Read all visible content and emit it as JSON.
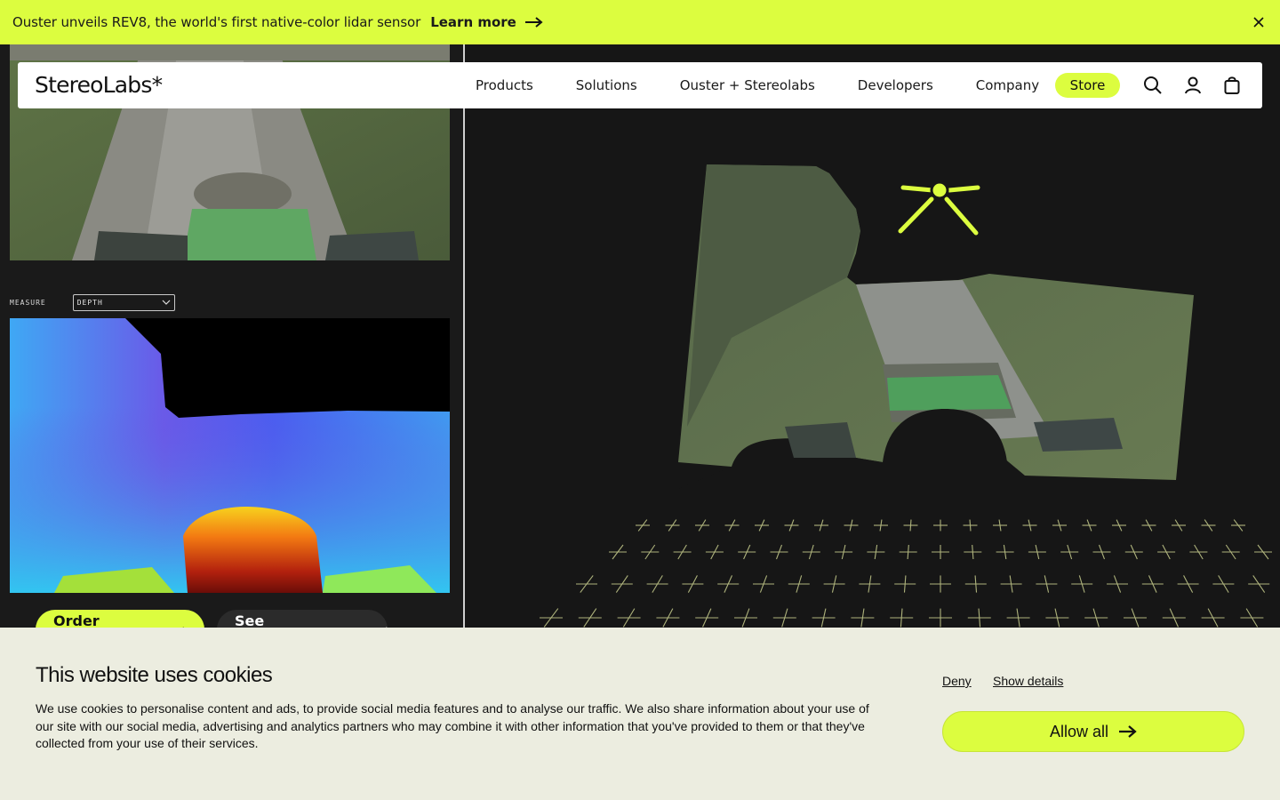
{
  "announcement": {
    "text": "Ouster unveils REV8, the world's first native-color lidar sensor",
    "link_label": "Learn more",
    "accent": "#dcfd3f"
  },
  "nav": {
    "logo": "StereoLabs*",
    "items": [
      {
        "label": "Products"
      },
      {
        "label": "Solutions"
      },
      {
        "label": "Ouster + Stereolabs"
      },
      {
        "label": "Developers"
      },
      {
        "label": "Company"
      }
    ],
    "store_label": "Store",
    "icons": [
      "search-icon",
      "account-icon",
      "cart-icon"
    ]
  },
  "viewer": {
    "measure_label": "MEASURE",
    "measure_value": "DEPTH",
    "cta_primary": "Order ZED",
    "cta_secondary": "See Technology"
  },
  "cookies": {
    "title": "This website uses cookies",
    "body": "We use cookies to personalise content and ads, to provide social media features and to analyse our traffic. We also share information about your use of our site with our social media, advertising and analytics partners who may combine it with other information that you've provided to them or that they've collected from your use of their services.",
    "deny_label": "Deny",
    "details_label": "Show details",
    "allow_label": "Allow all"
  }
}
